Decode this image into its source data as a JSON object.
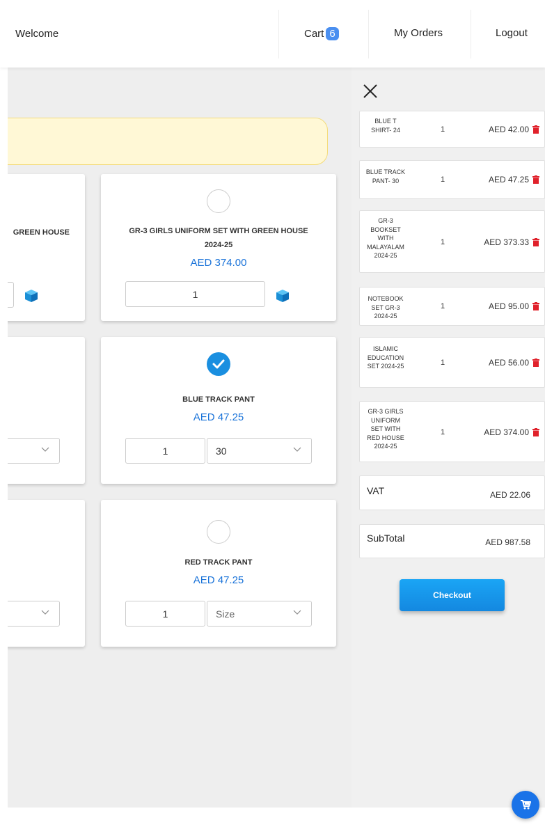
{
  "header": {
    "welcome": "Welcome",
    "cart_label": "Cart",
    "cart_count": "6",
    "my_orders": "My Orders",
    "logout": "Logout"
  },
  "products": {
    "left_partial_title": "GREEN HOUSE",
    "top": {
      "title_line1": "GR-3 GIRLS UNIFORM SET WITH GREEN HOUSE",
      "title_line2": "2024-25",
      "price": "AED 374.00",
      "qty": "1",
      "selected": false
    },
    "middle": {
      "title": "BLUE TRACK PANT",
      "price": "AED 47.25",
      "qty": "1",
      "size": "30",
      "selected": true
    },
    "bottom": {
      "title": "RED TRACK PANT",
      "price": "AED 47.25",
      "qty": "1",
      "size": "Size",
      "selected": false
    }
  },
  "cart": {
    "items": [
      {
        "name": "BLUE T SHIRT- 24",
        "qty": "1",
        "price": "AED 42.00"
      },
      {
        "name": "BLUE TRACK PANT- 30",
        "qty": "1",
        "price": "AED 47.25"
      },
      {
        "name": "GR-3 BOOKSET WITH MALAYALAM 2024-25",
        "qty": "1",
        "price": "AED 373.33"
      },
      {
        "name": "NOTEBOOK SET GR-3 2024-25",
        "qty": "1",
        "price": "AED 95.00"
      },
      {
        "name": "ISLAMIC EDUCATION SET 2024-25",
        "qty": "1",
        "price": "AED 56.00"
      },
      {
        "name": "GR-3 GIRLS UNIFORM SET WITH RED HOUSE 2024-25",
        "qty": "1",
        "price": "AED 374.00"
      }
    ],
    "vat_label": "VAT",
    "vat_value": "AED 22.06",
    "subtotal_label": "SubTotal",
    "subtotal_value": "AED 987.58",
    "checkout_label": "Checkout"
  },
  "colors": {
    "accent": "#1a73d9",
    "badge": "#4a8ff0",
    "checkout": "#1aa5f5",
    "trash": "#e0212b",
    "notice_bg": "#fff8d6"
  },
  "icons": [
    "close-icon",
    "cube-icon",
    "check-icon",
    "chevron-down-icon",
    "trash-icon",
    "cart-icon"
  ]
}
